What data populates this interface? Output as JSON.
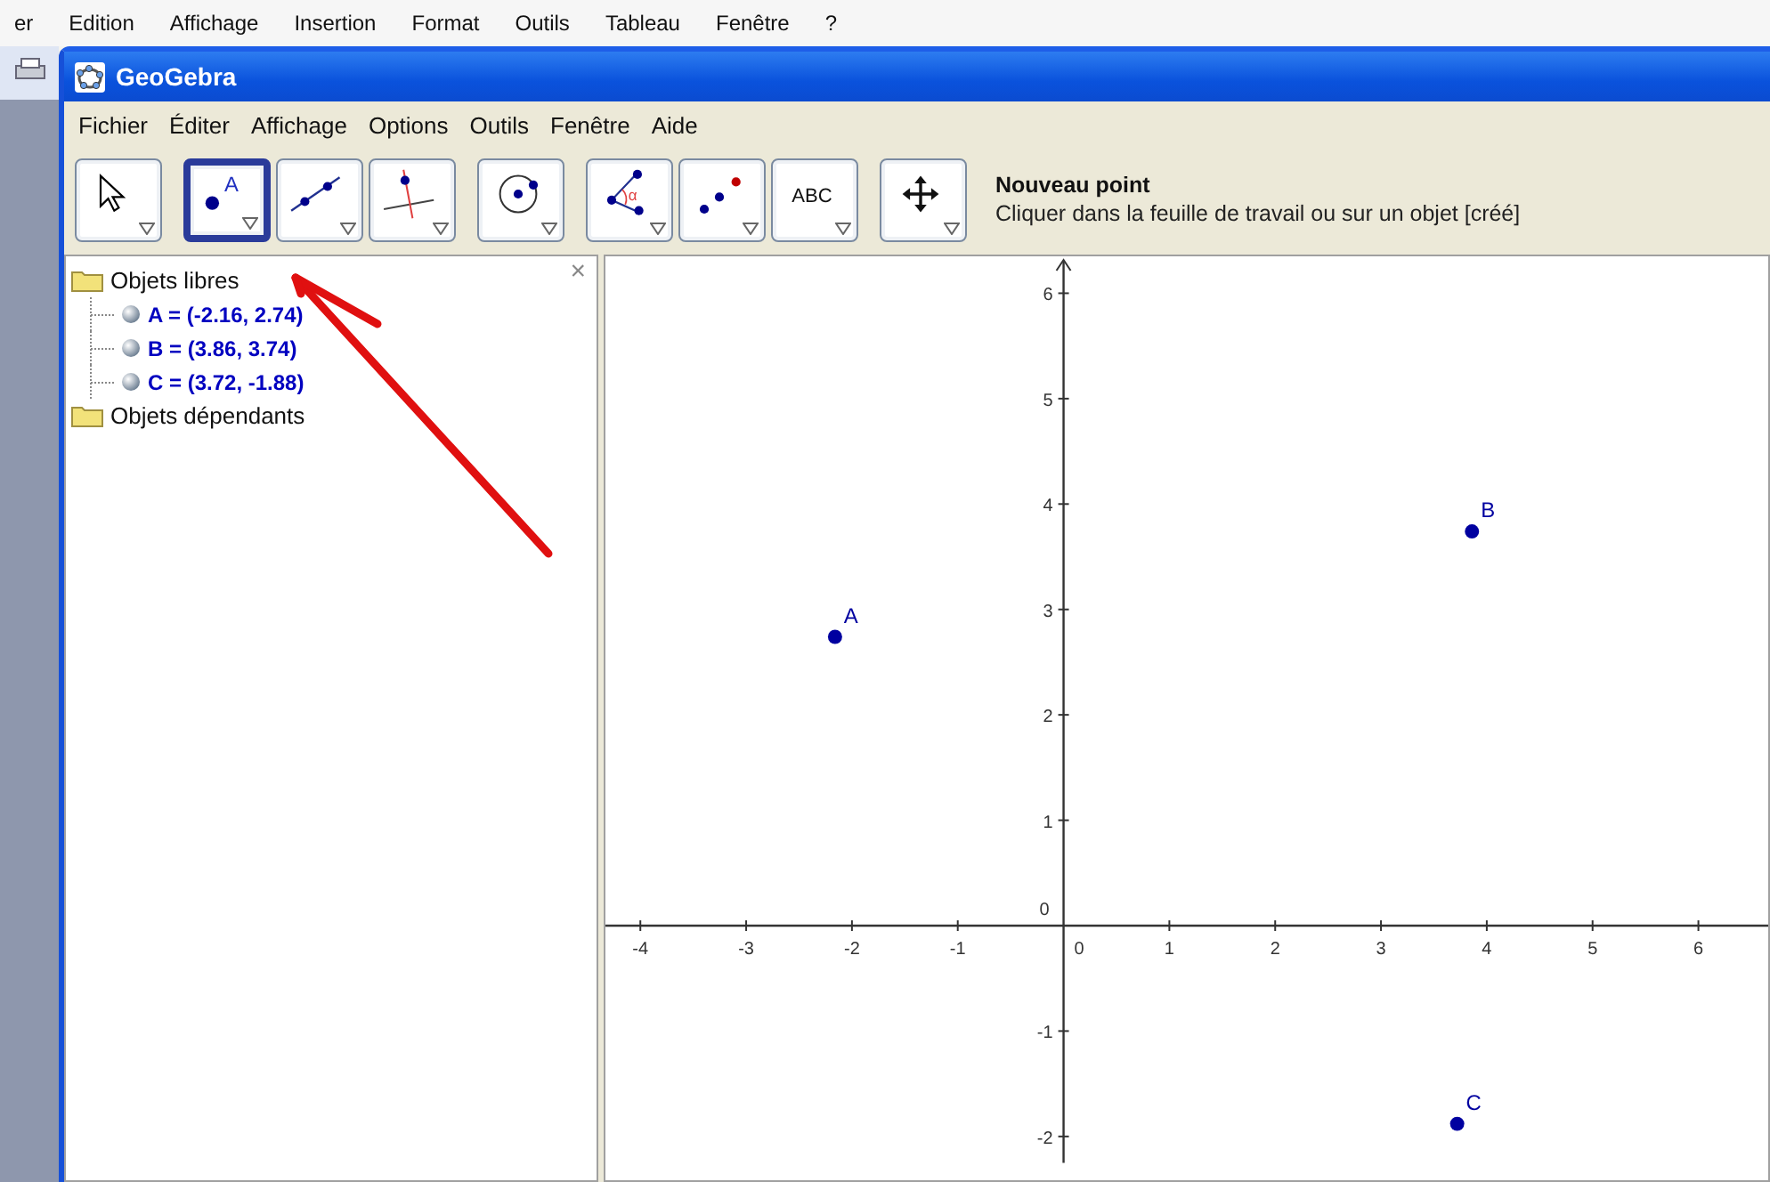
{
  "host_menu": [
    "er",
    "Edition",
    "Affichage",
    "Insertion",
    "Format",
    "Outils",
    "Tableau",
    "Fenêtre",
    "?"
  ],
  "window": {
    "title": "GeoGebra"
  },
  "menu": [
    "Fichier",
    "Éditer",
    "Affichage",
    "Options",
    "Outils",
    "Fenêtre",
    "Aide"
  ],
  "tool_groups": [
    [
      {
        "kind": "move",
        "selected": false
      }
    ],
    [
      {
        "kind": "point",
        "label": "A",
        "selected": true
      },
      {
        "kind": "line",
        "selected": false
      },
      {
        "kind": "perpendicular",
        "selected": false
      }
    ],
    [
      {
        "kind": "circle",
        "selected": false
      }
    ],
    [
      {
        "kind": "angle",
        "label": "α",
        "selected": false
      },
      {
        "kind": "reflect",
        "selected": false
      },
      {
        "kind": "text",
        "label": "ABC",
        "selected": false
      }
    ],
    [
      {
        "kind": "pan",
        "selected": false
      }
    ]
  ],
  "tool_info": {
    "title": "Nouveau point",
    "description": "Cliquer dans la feuille de travail ou sur un objet [créé]"
  },
  "algebra": {
    "close": "×",
    "folders": [
      {
        "label": "Objets libres",
        "children": [
          {
            "text": "A = (-2.16, 2.74)"
          },
          {
            "text": "B = (3.86, 3.74)"
          },
          {
            "text": "C = (3.72, -1.88)"
          }
        ]
      },
      {
        "label": "Objets dépendants"
      }
    ]
  },
  "graphics": {
    "x_origin_label": "0",
    "y_origin_label": "0",
    "chart_data": {
      "type": "scatter",
      "xlim": [
        -4.33,
        6.66
      ],
      "ylim": [
        -2.25,
        6.35
      ],
      "xticks": [
        -4,
        -3,
        -2,
        -1,
        1,
        2,
        3,
        4,
        5,
        6
      ],
      "yticks": [
        -2,
        -1,
        1,
        2,
        3,
        4,
        5,
        6
      ],
      "series": [
        {
          "name": "A",
          "color": "#0000a0",
          "x": [
            -2.16
          ],
          "values": [
            2.74
          ]
        },
        {
          "name": "B",
          "color": "#0000a0",
          "x": [
            3.86
          ],
          "values": [
            3.74
          ]
        },
        {
          "name": "C",
          "color": "#0000a0",
          "x": [
            3.72
          ],
          "values": [
            -1.88
          ]
        }
      ]
    }
  }
}
